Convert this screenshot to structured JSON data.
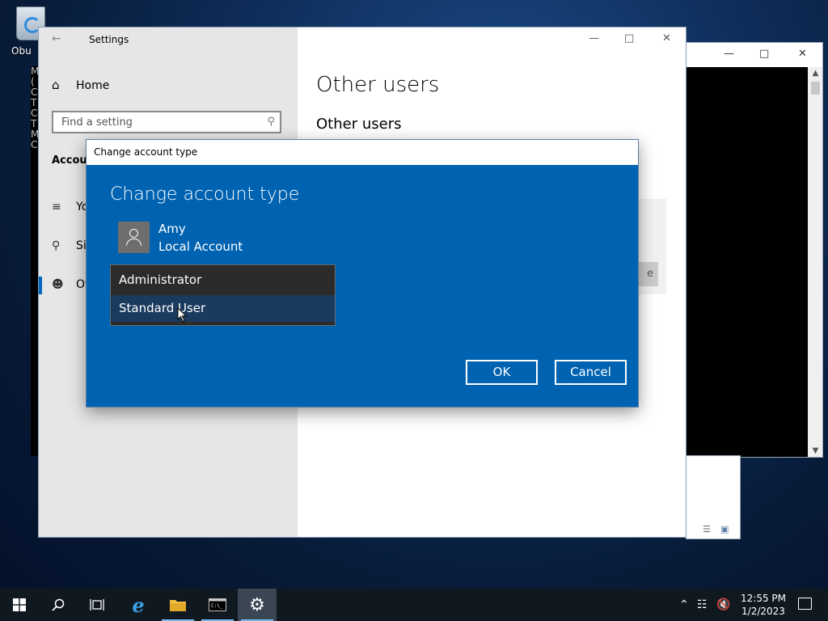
{
  "desktop": {
    "recycle_label": "Obu"
  },
  "console": {
    "left_chars": [
      "M",
      "(",
      "",
      "C",
      "T",
      "",
      "C",
      "T",
      "",
      "M",
      "",
      "C"
    ]
  },
  "settings": {
    "title": "Settings",
    "home_label": "Home",
    "search_placeholder": "Find a setting",
    "section_label": "Accou",
    "nav": [
      {
        "label": "Yo",
        "icon": "user-info-icon"
      },
      {
        "label": "Si",
        "icon": "key-icon"
      },
      {
        "label": "Ot",
        "icon": "person-icon"
      }
    ],
    "right_heading": "Other users",
    "right_subheading": "Other users",
    "ghost_button_fragment": "e"
  },
  "dialog": {
    "window_title": "Change account type",
    "heading": "Change account type",
    "user_name": "Amy",
    "user_type": "Local Account",
    "options": [
      "Administrator",
      "Standard User"
    ],
    "selected_option": "Standard User",
    "ok_label": "OK",
    "cancel_label": "Cancel"
  },
  "taskbar": {
    "time": "12:55 PM",
    "date": "1/2/2023",
    "accent": "#76b9ed"
  },
  "colors": {
    "dialog_blue": "#0063b1",
    "settings_sidebar": "#e6e6e6",
    "nav_accent": "#0067c0"
  }
}
